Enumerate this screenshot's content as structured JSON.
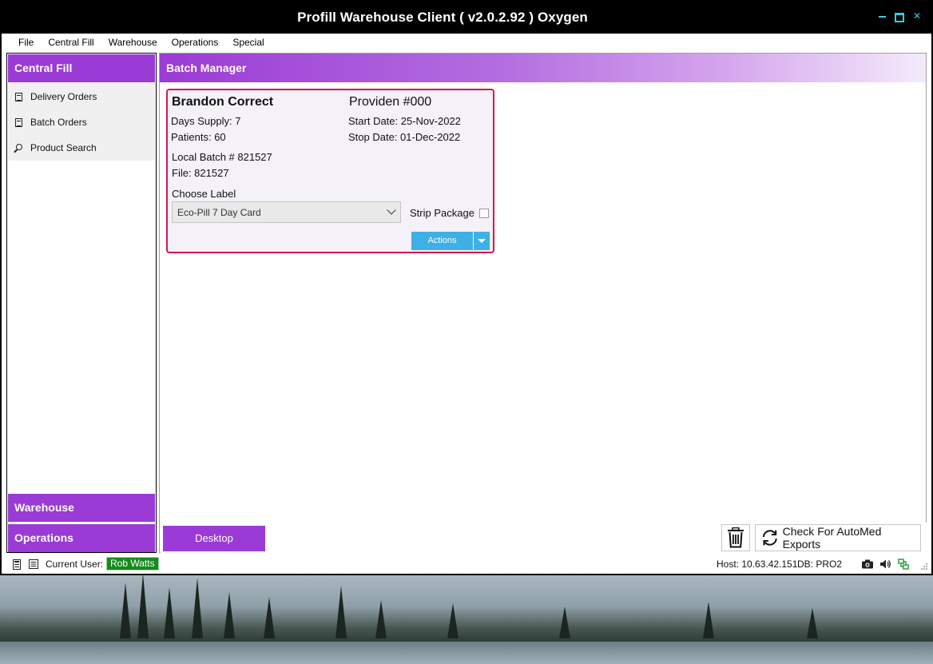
{
  "window": {
    "title": "Profill Warehouse Client ( v2.0.2.92 ) Oxygen"
  },
  "menu": {
    "items": [
      "File",
      "Central Fill",
      "Warehouse",
      "Operations",
      "Special"
    ]
  },
  "sidebar": {
    "section_central_fill": "Central Fill",
    "items": [
      {
        "label": "Delivery Orders",
        "icon": "delivery-orders-icon"
      },
      {
        "label": "Batch Orders",
        "icon": "batch-orders-icon"
      },
      {
        "label": "Product Search",
        "icon": "search-icon"
      }
    ],
    "section_warehouse": "Warehouse",
    "section_operations": "Operations"
  },
  "main": {
    "title": "Batch Manager"
  },
  "batch_card": {
    "patient_name": "Brandon Correct",
    "provider": "Providen #000",
    "days_supply": "Days Supply: 7",
    "patients": "Patients: 60",
    "start_date": "Start Date: 25-Nov-2022",
    "stop_date": "Stop Date: 01-Dec-2022",
    "local_batch": "Local Batch # 821527",
    "file": "File:  821527",
    "choose_label_caption": "Choose Label",
    "selected_label": "Eco-Pill 7 Day Card",
    "strip_package_label": "Strip Package",
    "strip_package_checked": false,
    "actions_label": "Actions"
  },
  "bottom_bar": {
    "desktop_label": "Desktop",
    "check_exports_label": "Check For AutoMed Exports"
  },
  "status": {
    "current_user_label": "Current User:",
    "current_user": "Rob Watts",
    "host": "Host: 10.63.42.151",
    "db": "DB: PRO2"
  },
  "colors": {
    "accent_purple": "#9a3bd5",
    "card_border": "#d4184f",
    "actions_blue": "#3fb0e6",
    "user_badge_green": "#178a1e",
    "window_control_cyan": "#2fd0e0"
  }
}
